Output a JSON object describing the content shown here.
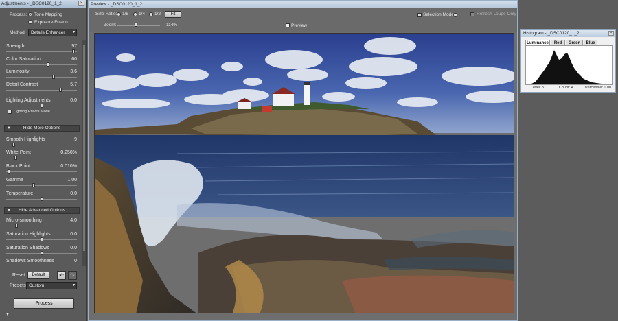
{
  "adjustments": {
    "title": "Adjustments - _DSC0120_1_2",
    "process_label": "Process:",
    "process_options": [
      "Tone Mapping",
      "Exposure Fusion"
    ],
    "method_label": "Method:",
    "method_value": "Details Enhancer",
    "sliders": [
      {
        "label": "Strength",
        "value": "97",
        "pos": 0.97
      },
      {
        "label": "Color Saturation",
        "value": "60",
        "pos": 0.6
      },
      {
        "label": "Luminosity",
        "value": "3.6",
        "pos": 0.68
      },
      {
        "label": "Detail Contrast",
        "value": "5.7",
        "pos": 0.78
      },
      {
        "label": "Lighting Adjustments",
        "value": "0.0",
        "pos": 0.5
      }
    ],
    "lighting_mode_label": "Lighting Effects Mode",
    "more_options_label": "Hide More Options",
    "more_sliders": [
      {
        "label": "Smooth Highlights",
        "value": "9",
        "pos": 0.09
      },
      {
        "label": "White Point",
        "value": "0.250%",
        "pos": 0.12
      },
      {
        "label": "Black Point",
        "value": "0.010%",
        "pos": 0.02
      },
      {
        "label": "Gamma",
        "value": "1.00",
        "pos": 0.38
      },
      {
        "label": "Temperature",
        "value": "0.0",
        "pos": 0.5
      }
    ],
    "advanced_label": "Hide Advanced Options",
    "adv_sliders": [
      {
        "label": "Micro-smoothing",
        "value": "4.0",
        "pos": 0.13
      },
      {
        "label": "Saturation Highlights",
        "value": "0.0",
        "pos": 0.5
      },
      {
        "label": "Saturation Shadows",
        "value": "0.0",
        "pos": 0.5
      },
      {
        "label": "Shadows Smoothness",
        "value": "0",
        "pos": 0.0
      }
    ],
    "reset_label": "Reset:",
    "default_label": "Default",
    "presets_label": "Presets:",
    "presets_value": "Custom",
    "process_button": "Process"
  },
  "preview": {
    "title": "Preview - _DSC0120_1_2",
    "size_ratio_label": "Size Ratio:",
    "ratios": [
      "1/8",
      "1/4",
      "1/2"
    ],
    "fit_label": "Fit",
    "selection_mode_label": "Selection Mode",
    "refresh_label": "Refresh Loupe Only",
    "zoom_label": "Zoom:",
    "zoom_value": "114%",
    "preview_label": "Preview"
  },
  "histogram": {
    "title": "Histogram - _DSC0120_1_2",
    "tabs": [
      "Luminance",
      "Red",
      "Green",
      "Blue"
    ],
    "level": "Level: 5",
    "count": "Count: 4",
    "percentile": "Percentile: 0.00"
  },
  "colors": {
    "panel_bg": "#5a5a5a",
    "titlebar": "#b5c7da",
    "sky": "#2f4f9a",
    "sea": "#2c4a78"
  }
}
